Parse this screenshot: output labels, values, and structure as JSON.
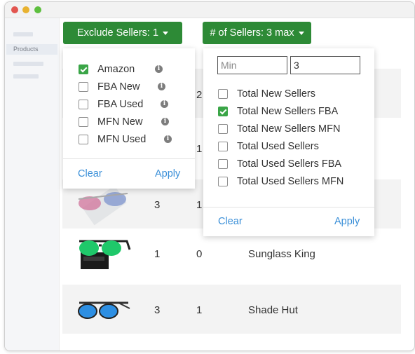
{
  "window": {
    "dot_colors": [
      "#e2554f",
      "#e8b230",
      "#5dbf3e"
    ]
  },
  "sidebar": {
    "active_item": "Products"
  },
  "exclude_sellers": {
    "button_label": "Exclude Sellers: 1",
    "options": [
      {
        "label": "Amazon",
        "checked": true
      },
      {
        "label": "FBA New",
        "checked": false
      },
      {
        "label": "FBA Used",
        "checked": false
      },
      {
        "label": "MFN New",
        "checked": false
      },
      {
        "label": "MFN Used",
        "checked": false
      }
    ],
    "clear_label": "Clear",
    "apply_label": "Apply"
  },
  "num_sellers": {
    "button_label": "# of Sellers: 3 max",
    "min_placeholder": "Min",
    "max_value": "3",
    "options": [
      {
        "label": "Total New Sellers",
        "checked": false
      },
      {
        "label": "Total New Sellers FBA",
        "checked": true
      },
      {
        "label": "Total New Sellers MFN",
        "checked": false
      },
      {
        "label": "Total Used Sellers",
        "checked": false
      },
      {
        "label": "Total Used Sellers FBA",
        "checked": false
      },
      {
        "label": "Total Used Sellers MFN",
        "checked": false
      }
    ],
    "clear_label": "Clear",
    "apply_label": "Apply"
  },
  "table": {
    "rows": [
      {
        "c1": "",
        "c2": "2",
        "seller": ""
      },
      {
        "c1": "",
        "c2": "1",
        "seller": ""
      },
      {
        "c1": "3",
        "c2": "1",
        "seller": ""
      },
      {
        "c1": "1",
        "c2": "0",
        "seller": "Sunglass King"
      },
      {
        "c1": "3",
        "c2": "1",
        "seller": "Shade Hut"
      }
    ]
  }
}
